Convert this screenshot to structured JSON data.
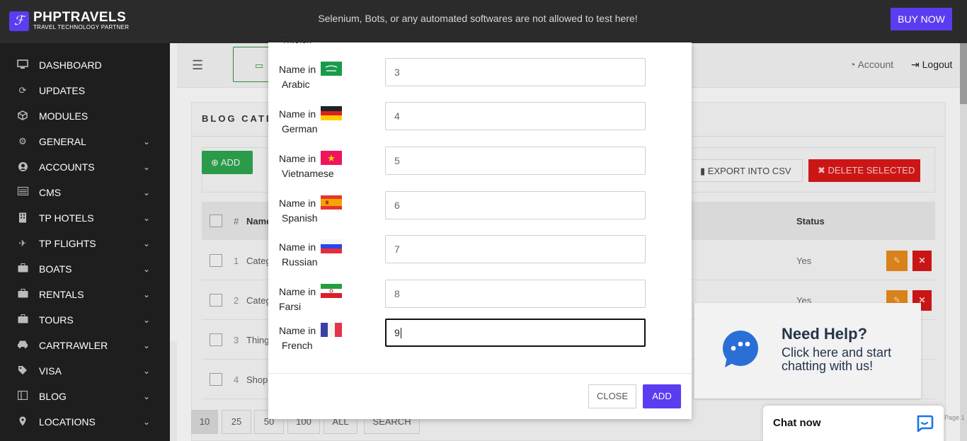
{
  "header": {
    "brand_name": "PHPTRAVELS",
    "brand_tagline": "TRAVEL TECHNOLOGY PARTNER",
    "notice": "Selenium, Bots, or any automated softwares are not allowed to test here!",
    "buy_now": "BUY NOW"
  },
  "sidebar": {
    "items": [
      {
        "label": "DASHBOARD",
        "icon": "monitor-icon"
      },
      {
        "label": "UPDATES",
        "icon": "refresh-icon"
      },
      {
        "label": "MODULES",
        "icon": "cube-icon"
      },
      {
        "label": "GENERAL",
        "icon": "gear-icon"
      },
      {
        "label": "ACCOUNTS",
        "icon": "user-circle-icon"
      },
      {
        "label": "CMS",
        "icon": "list-icon"
      },
      {
        "label": "TP HOTELS",
        "icon": "building-icon"
      },
      {
        "label": "TP FLIGHTS",
        "icon": "plane-icon"
      },
      {
        "label": "BOATS",
        "icon": "briefcase-icon"
      },
      {
        "label": "RENTALS",
        "icon": "briefcase-icon"
      },
      {
        "label": "TOURS",
        "icon": "briefcase-icon"
      },
      {
        "label": "CARTRAWLER",
        "icon": "car-icon"
      },
      {
        "label": "VISA",
        "icon": "tag-icon"
      },
      {
        "label": "BLOG",
        "icon": "columns-icon"
      },
      {
        "label": "LOCATIONS",
        "icon": "map-pin-icon"
      }
    ]
  },
  "topnav": {
    "account": "Account",
    "logout": "Logout"
  },
  "panel": {
    "title": "BLOG CATE",
    "add_label": "ADD",
    "export_label": "EXPORT INTO CSV",
    "delete_label": "DELETE SELECTED",
    "col_hash": "#",
    "col_name": "Name",
    "col_status": "Status",
    "rows": [
      {
        "num": "1",
        "name": "Categ",
        "status": "Yes"
      },
      {
        "num": "2",
        "name": "Categ",
        "status": "Yes"
      },
      {
        "num": "3",
        "name": "Thing",
        "status": ""
      },
      {
        "num": "4",
        "name": "Shop",
        "status": ""
      }
    ],
    "pager": [
      "10",
      "25",
      "50",
      "100",
      "ALL",
      "SEARCH"
    ],
    "pager_tail": "Page 1"
  },
  "modal": {
    "cut_label": "Turkish",
    "prefix": "Name in",
    "fields": [
      {
        "lang": "Arabic",
        "value": "3",
        "flag": "flag-sa-icon"
      },
      {
        "lang": "German",
        "value": "4",
        "flag": "flag-de-icon"
      },
      {
        "lang": "Vietnamese",
        "value": "5",
        "flag": "flag-vn-icon"
      },
      {
        "lang": "Spanish",
        "value": "6",
        "flag": "flag-es-icon"
      },
      {
        "lang": "Russian",
        "value": "7",
        "flag": "flag-ru-icon"
      },
      {
        "lang": "Farsi",
        "value": "8",
        "flag": "flag-ir-icon"
      },
      {
        "lang": "French",
        "value": "9",
        "flag": "flag-fr-icon"
      }
    ],
    "close_label": "CLOSE",
    "add_label": "ADD"
  },
  "help": {
    "title": "Need Help?",
    "subtitle": "Click here and start chatting with us!",
    "chat_label": "Chat now"
  },
  "colors": {
    "brand": "#5b3cf0",
    "sidebar_bg": "#1e1e1e",
    "topbar_bg": "#2b2b2b",
    "success": "#2a9b48",
    "danger": "#cc1616",
    "warning": "#d9811a"
  }
}
